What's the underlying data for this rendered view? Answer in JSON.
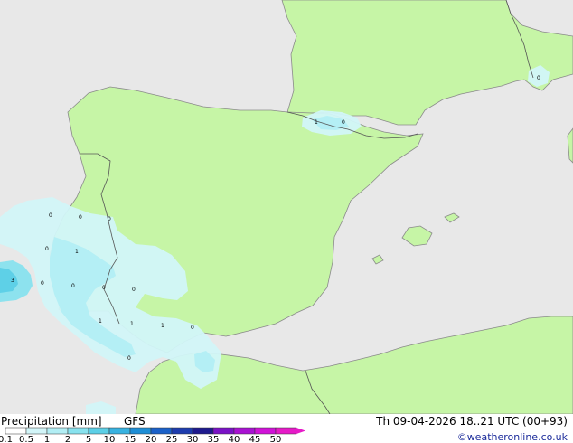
{
  "colors": {
    "sea": "#e8e8e8",
    "land": "#c6f5a6",
    "border": "#555555",
    "coast": "#8a8a8a"
  },
  "labels": [
    "0",
    "0",
    "0",
    "0",
    "1",
    "0",
    "0",
    "0",
    "3",
    "1",
    "1",
    "1",
    "0",
    "0",
    "0",
    "1",
    "0",
    "0"
  ],
  "legend": {
    "title_left": "Precipitation [mm]",
    "model": "GFS",
    "datetime": "Th 09-04-2026 18..21 UTC (00+93)",
    "credit": "©weatheronline.co.uk",
    "ticks": [
      "0.1",
      "0.5",
      "1",
      "2",
      "5",
      "10",
      "15",
      "20",
      "25",
      "30",
      "35",
      "40",
      "45",
      "50"
    ],
    "colors": [
      "#ffffff",
      "#d2f5f8",
      "#b2eef4",
      "#88e2ee",
      "#5ccfe6",
      "#38b2e0",
      "#1e8ed6",
      "#1a60c8",
      "#1d3cae",
      "#1e1a8e",
      "#7a12c6",
      "#a812d2",
      "#d012d8",
      "#e61ac8"
    ]
  }
}
